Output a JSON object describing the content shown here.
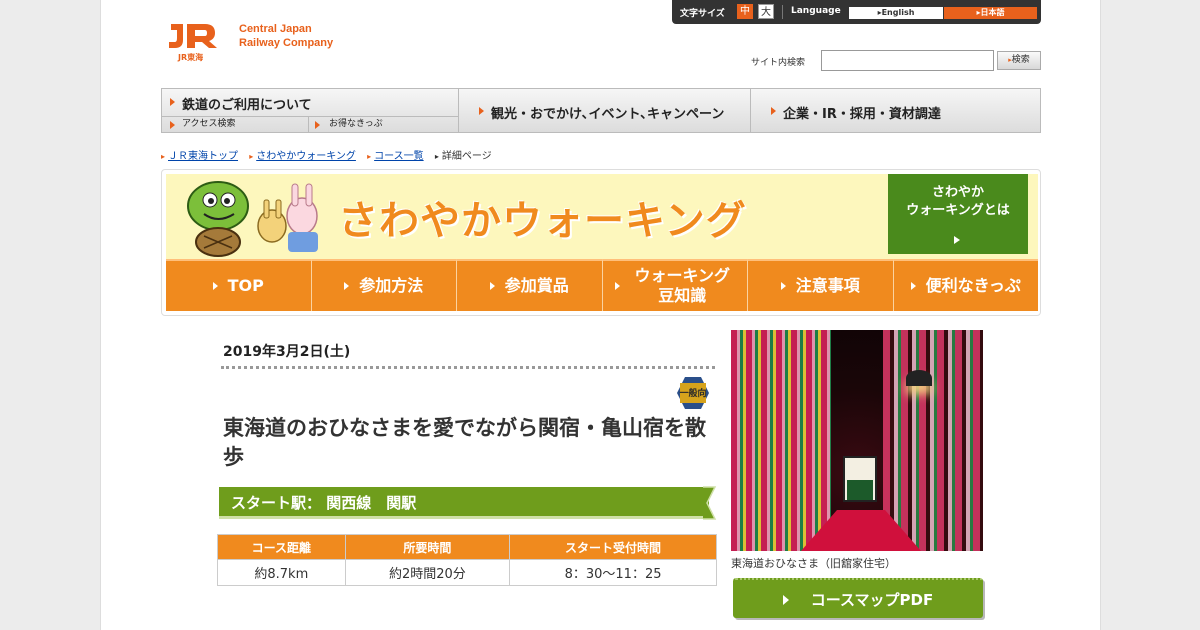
{
  "header": {
    "logo_mark": "JR",
    "logo_name_line1": "Central Japan",
    "logo_name_line2": "Railway Company",
    "logo_sub": "JR東海"
  },
  "utility": {
    "font_size_label": "文字サイズ",
    "font_mid": "中",
    "font_big": "大",
    "language_label": "Language",
    "lang_en": "English",
    "lang_ja": "日本語"
  },
  "search": {
    "label": "サイト内検索",
    "placeholder": "",
    "button": "検索"
  },
  "gnav": {
    "item1": "鉄道のご利用について",
    "item1_sub1": "アクセス検索",
    "item1_sub2": "お得なきっぷ",
    "item2": "観光・おでかけ､イベント､キャンペーン",
    "item3": "企業・IR・採用・資材調達"
  },
  "breadcrumb": {
    "item1": "ＪＲ東海トップ",
    "item2": "さわやかウォーキング",
    "item3": "コース一覧",
    "current": "詳細ページ"
  },
  "banner": {
    "title": "さわやかウォーキング",
    "about_line1": "さわやか",
    "about_line2": "ウォーキングとは",
    "menu": [
      "TOP",
      "参加方法",
      "参加賞品",
      "ウォーキング豆知識",
      "注意事項",
      "便利なきっぷ"
    ]
  },
  "course": {
    "date": "2019年3月2日(土)",
    "badge": "一般向",
    "title": "東海道のおひなさまを愛でながら関宿・亀山宿を散歩",
    "start_station": "スタート駅： 関西線　関駅",
    "table_headers": [
      "コース距離",
      "所要時間",
      "スタート受付時間"
    ],
    "table_values": [
      "約8.7km",
      "約2時間20分",
      "8：30～11：25"
    ]
  },
  "photo": {
    "caption": "東海道おひなさま（旧舘家住宅）",
    "pdf_button": "コースマップPDF"
  },
  "colors": {
    "brand_orange": "#e8611c",
    "menu_orange": "#f08a1e",
    "green": "#6f9d1c",
    "banner_yellow": "#fdf7bd"
  }
}
